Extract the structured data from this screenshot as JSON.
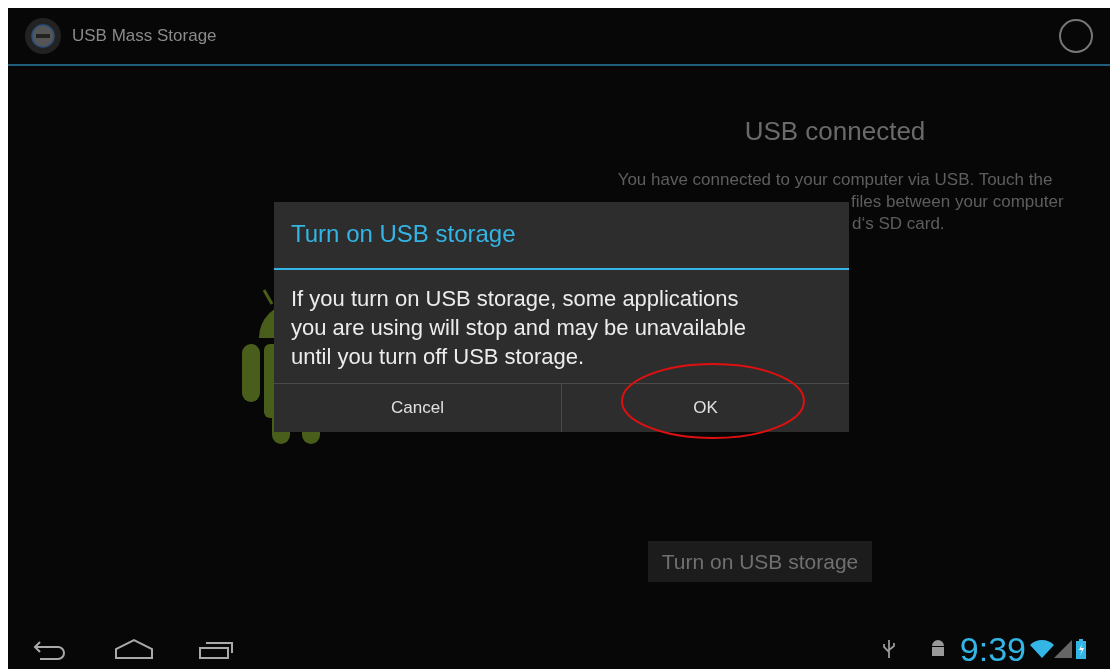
{
  "action_bar": {
    "title": "USB Mass Storage"
  },
  "content": {
    "heading": "USB connected",
    "description_lines": [
      "You have connected to your computer via USB. Touch the",
      "files between your computer",
      "d‘s SD card."
    ],
    "button": "Turn on USB storage"
  },
  "dialog": {
    "title": "Turn on USB storage",
    "message": "If you turn on USB storage, some applications you are using will stop and may be unavailable until you turn off USB storage.",
    "buttons": [
      {
        "label": "Cancel",
        "circled": false
      },
      {
        "label": "OK",
        "circled": true
      }
    ]
  },
  "status_bar": {
    "time": "9:39"
  }
}
